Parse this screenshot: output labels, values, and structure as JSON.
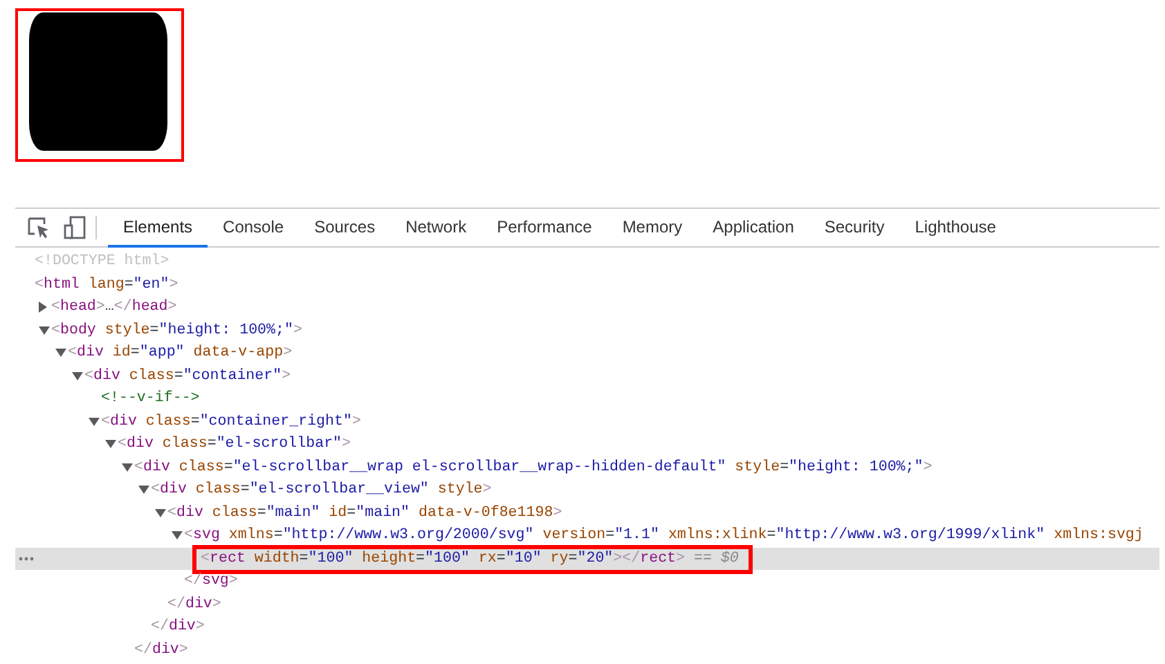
{
  "devtools": {
    "tabs": [
      {
        "label": "Elements",
        "selected": true
      },
      {
        "label": "Console",
        "selected": false
      },
      {
        "label": "Sources",
        "selected": false
      },
      {
        "label": "Network",
        "selected": false
      },
      {
        "label": "Performance",
        "selected": false
      },
      {
        "label": "Memory",
        "selected": false
      },
      {
        "label": "Application",
        "selected": false
      },
      {
        "label": "Security",
        "selected": false
      },
      {
        "label": "Lighthouse",
        "selected": false
      }
    ],
    "dom_tree": [
      {
        "selected": false,
        "segments": [
          {
            "kind": "doctype",
            "text": "<!DOCTYPE html>"
          }
        ]
      },
      {
        "selected": false,
        "segments": [
          {
            "kind": "punct",
            "text": "<"
          },
          {
            "kind": "tag",
            "text": "html"
          },
          {
            "kind": "attr",
            "text": " lang"
          },
          {
            "kind": "plain",
            "text": "="
          },
          {
            "kind": "value",
            "text": "\"en\""
          },
          {
            "kind": "punct",
            "text": ">"
          }
        ],
        "children": [
          {
            "selected": false,
            "expanded": false,
            "segments": [
              {
                "kind": "punct",
                "text": "<"
              },
              {
                "kind": "tag",
                "text": "head"
              },
              {
                "kind": "punct",
                "text": ">"
              },
              {
                "kind": "plain",
                "text": "…"
              },
              {
                "kind": "punct",
                "text": "</"
              },
              {
                "kind": "tag",
                "text": "head"
              },
              {
                "kind": "punct",
                "text": ">"
              }
            ]
          },
          {
            "selected": false,
            "expanded": true,
            "segments": [
              {
                "kind": "punct",
                "text": "<"
              },
              {
                "kind": "tag",
                "text": "body"
              },
              {
                "kind": "attr",
                "text": " style"
              },
              {
                "kind": "plain",
                "text": "="
              },
              {
                "kind": "value",
                "text": "\"height: 100%;\""
              },
              {
                "kind": "punct",
                "text": ">"
              }
            ],
            "children": [
              {
                "selected": false,
                "expanded": true,
                "segments": [
                  {
                    "kind": "punct",
                    "text": "<"
                  },
                  {
                    "kind": "tag",
                    "text": "div"
                  },
                  {
                    "kind": "attr",
                    "text": " id"
                  },
                  {
                    "kind": "plain",
                    "text": "="
                  },
                  {
                    "kind": "value",
                    "text": "\"app\""
                  },
                  {
                    "kind": "attr",
                    "text": " data-v-app"
                  },
                  {
                    "kind": "punct",
                    "text": ">"
                  }
                ],
                "children": [
                  {
                    "selected": false,
                    "expanded": true,
                    "segments": [
                      {
                        "kind": "punct",
                        "text": "<"
                      },
                      {
                        "kind": "tag",
                        "text": "div"
                      },
                      {
                        "kind": "attr",
                        "text": " class"
                      },
                      {
                        "kind": "plain",
                        "text": "="
                      },
                      {
                        "kind": "value",
                        "text": "\"container\""
                      },
                      {
                        "kind": "punct",
                        "text": ">"
                      }
                    ],
                    "children": [
                      {
                        "selected": false,
                        "segments": [
                          {
                            "kind": "comment",
                            "text": "<!--v-if-->"
                          }
                        ]
                      },
                      {
                        "selected": false,
                        "expanded": true,
                        "segments": [
                          {
                            "kind": "punct",
                            "text": "<"
                          },
                          {
                            "kind": "tag",
                            "text": "div"
                          },
                          {
                            "kind": "attr",
                            "text": " class"
                          },
                          {
                            "kind": "plain",
                            "text": "="
                          },
                          {
                            "kind": "value",
                            "text": "\"container_right\""
                          },
                          {
                            "kind": "punct",
                            "text": ">"
                          }
                        ],
                        "children": [
                          {
                            "selected": false,
                            "expanded": true,
                            "segments": [
                              {
                                "kind": "punct",
                                "text": "<"
                              },
                              {
                                "kind": "tag",
                                "text": "div"
                              },
                              {
                                "kind": "attr",
                                "text": " class"
                              },
                              {
                                "kind": "plain",
                                "text": "="
                              },
                              {
                                "kind": "value",
                                "text": "\"el-scrollbar\""
                              },
                              {
                                "kind": "punct",
                                "text": ">"
                              }
                            ],
                            "children": [
                              {
                                "selected": false,
                                "expanded": true,
                                "segments": [
                                  {
                                    "kind": "punct",
                                    "text": "<"
                                  },
                                  {
                                    "kind": "tag",
                                    "text": "div"
                                  },
                                  {
                                    "kind": "attr",
                                    "text": " class"
                                  },
                                  {
                                    "kind": "plain",
                                    "text": "="
                                  },
                                  {
                                    "kind": "value",
                                    "text": "\"el-scrollbar__wrap el-scrollbar__wrap--hidden-default\""
                                  },
                                  {
                                    "kind": "attr",
                                    "text": " style"
                                  },
                                  {
                                    "kind": "plain",
                                    "text": "="
                                  },
                                  {
                                    "kind": "value",
                                    "text": "\"height: 100%;\""
                                  },
                                  {
                                    "kind": "punct",
                                    "text": ">"
                                  }
                                ],
                                "closing": [
                                  {
                                    "kind": "punct",
                                    "text": "</"
                                  },
                                  {
                                    "kind": "tag",
                                    "text": "div"
                                  },
                                  {
                                    "kind": "punct",
                                    "text": ">"
                                  }
                                ],
                                "children": [
                                  {
                                    "selected": false,
                                    "expanded": true,
                                    "segments": [
                                      {
                                        "kind": "punct",
                                        "text": "<"
                                      },
                                      {
                                        "kind": "tag",
                                        "text": "div"
                                      },
                                      {
                                        "kind": "attr",
                                        "text": " class"
                                      },
                                      {
                                        "kind": "plain",
                                        "text": "="
                                      },
                                      {
                                        "kind": "value",
                                        "text": "\"el-scrollbar__view\""
                                      },
                                      {
                                        "kind": "attr",
                                        "text": " style"
                                      },
                                      {
                                        "kind": "punct",
                                        "text": ">"
                                      }
                                    ],
                                    "closing": [
                                      {
                                        "kind": "punct",
                                        "text": "</"
                                      },
                                      {
                                        "kind": "tag",
                                        "text": "div"
                                      },
                                      {
                                        "kind": "punct",
                                        "text": ">"
                                      }
                                    ],
                                    "children": [
                                      {
                                        "selected": false,
                                        "expanded": true,
                                        "segments": [
                                          {
                                            "kind": "punct",
                                            "text": "<"
                                          },
                                          {
                                            "kind": "tag",
                                            "text": "div"
                                          },
                                          {
                                            "kind": "attr",
                                            "text": " class"
                                          },
                                          {
                                            "kind": "plain",
                                            "text": "="
                                          },
                                          {
                                            "kind": "value",
                                            "text": "\"main\""
                                          },
                                          {
                                            "kind": "attr",
                                            "text": " id"
                                          },
                                          {
                                            "kind": "plain",
                                            "text": "="
                                          },
                                          {
                                            "kind": "value",
                                            "text": "\"main\""
                                          },
                                          {
                                            "kind": "attr",
                                            "text": " data-v-0f8e1198"
                                          },
                                          {
                                            "kind": "punct",
                                            "text": ">"
                                          }
                                        ],
                                        "closing": [
                                          {
                                            "kind": "punct",
                                            "text": "</"
                                          },
                                          {
                                            "kind": "tag",
                                            "text": "div"
                                          },
                                          {
                                            "kind": "punct",
                                            "text": ">"
                                          }
                                        ],
                                        "children": [
                                          {
                                            "selected": false,
                                            "expanded": true,
                                            "segments": [
                                              {
                                                "kind": "punct",
                                                "text": "<"
                                              },
                                              {
                                                "kind": "tag",
                                                "text": "svg"
                                              },
                                              {
                                                "kind": "attr",
                                                "text": " xmlns"
                                              },
                                              {
                                                "kind": "plain",
                                                "text": "="
                                              },
                                              {
                                                "kind": "value",
                                                "text": "\"http://www.w3.org/2000/svg\""
                                              },
                                              {
                                                "kind": "attr",
                                                "text": " version"
                                              },
                                              {
                                                "kind": "plain",
                                                "text": "="
                                              },
                                              {
                                                "kind": "value",
                                                "text": "\"1.1\""
                                              },
                                              {
                                                "kind": "attr",
                                                "text": " xmlns:xlink"
                                              },
                                              {
                                                "kind": "plain",
                                                "text": "="
                                              },
                                              {
                                                "kind": "value",
                                                "text": "\"http://www.w3.org/1999/xlink\""
                                              },
                                              {
                                                "kind": "attr",
                                                "text": " xmlns:svgj"
                                              }
                                            ],
                                            "closing": [
                                              {
                                                "kind": "punct",
                                                "text": "</"
                                              },
                                              {
                                                "kind": "tag",
                                                "text": "svg"
                                              },
                                              {
                                                "kind": "punct",
                                                "text": ">"
                                              }
                                            ],
                                            "children": [
                                              {
                                                "selected": true,
                                                "segments": [
                                                  {
                                                    "kind": "punct",
                                                    "text": "<"
                                                  },
                                                  {
                                                    "kind": "tag",
                                                    "text": "rect"
                                                  },
                                                  {
                                                    "kind": "attr",
                                                    "text": " width"
                                                  },
                                                  {
                                                    "kind": "plain",
                                                    "text": "="
                                                  },
                                                  {
                                                    "kind": "value",
                                                    "text": "\"100\""
                                                  },
                                                  {
                                                    "kind": "attr",
                                                    "text": " height"
                                                  },
                                                  {
                                                    "kind": "plain",
                                                    "text": "="
                                                  },
                                                  {
                                                    "kind": "value",
                                                    "text": "\"100\""
                                                  },
                                                  {
                                                    "kind": "attr",
                                                    "text": " rx"
                                                  },
                                                  {
                                                    "kind": "plain",
                                                    "text": "="
                                                  },
                                                  {
                                                    "kind": "value",
                                                    "text": "\"10\""
                                                  },
                                                  {
                                                    "kind": "attr",
                                                    "text": " ry"
                                                  },
                                                  {
                                                    "kind": "plain",
                                                    "text": "="
                                                  },
                                                  {
                                                    "kind": "value",
                                                    "text": "\"20\""
                                                  },
                                                  {
                                                    "kind": "punct",
                                                    "text": ">"
                                                  },
                                                  {
                                                    "kind": "punct",
                                                    "text": "</"
                                                  },
                                                  {
                                                    "kind": "tag",
                                                    "text": "rect"
                                                  },
                                                  {
                                                    "kind": "punct",
                                                    "text": ">"
                                                  },
                                                  {
                                                    "kind": "console-ref",
                                                    "text": " == $0"
                                                  }
                                                ]
                                              }
                                            ]
                                          }
                                        ]
                                      }
                                    ]
                                  }
                                ]
                              }
                            ]
                          }
                        ]
                      }
                    ]
                  }
                ]
              }
            ]
          }
        ]
      }
    ]
  }
}
